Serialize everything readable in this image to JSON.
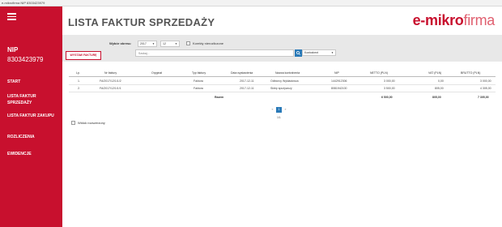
{
  "window": {
    "title": "e-mikrofirma NIP 8303423979"
  },
  "sidebar": {
    "nip_label": "NIP",
    "nip_value": "8303423979",
    "items": [
      {
        "label": "START"
      },
      {
        "label": "LISTA FAKTUR SPRZEDAŻY"
      },
      {
        "label": "LISTA FAKTUR ZAKUPU"
      },
      {
        "label": "ROZLICZENIA"
      },
      {
        "label": "EWIDENCJE"
      }
    ]
  },
  "header": {
    "title": "LISTA FAKTUR SPRZEDAŻY",
    "logo_main": "e-mikro",
    "logo_light": "firma"
  },
  "filters": {
    "add_button": "WYSTAW FAKTURĘ",
    "range_label": "Wybór okresu",
    "year": "2017",
    "month": "12",
    "corrections_label": "Korekty nierozliczone",
    "search_placeholder": "Szukaj...",
    "sort": "Kontrahent"
  },
  "table": {
    "headers": [
      "Lp.",
      "Nr faktury",
      "Oryginał",
      "Typ faktury",
      "Data wystawienia",
      "Nazwa kontrahenta",
      "NIP",
      "NETTO (PLN)",
      "VAT (PLN)",
      "BRUTTO (PLN)"
    ],
    "rows": [
      [
        "1.",
        "FA/2017/12/1/1/2",
        "",
        "Faktura",
        "2017-12-11",
        "Odbiorcy Wykładowca",
        "1442912306",
        "3 000,00",
        "0,00",
        "3 000,00"
      ],
      [
        "2.",
        "FA/2017/12/1/1/1",
        "",
        "Faktura",
        "2017-12-11",
        "Sklep spożywczy",
        "8081942100",
        "3 500,00",
        "805,00",
        "4 305,00"
      ]
    ],
    "sum_label": "Razem",
    "sum_netto": "6 500,00",
    "sum_vat": "805,00",
    "sum_brutto": "7 305,00"
  },
  "pager": {
    "prev": "«",
    "current": "1",
    "next": "»",
    "info": "1/1"
  },
  "extended_view_label": "Widok rozszerzony",
  "colors": {
    "brand": "#c8102e",
    "accent": "#2a7ab8",
    "filter_bg": "#e8e8e8"
  }
}
